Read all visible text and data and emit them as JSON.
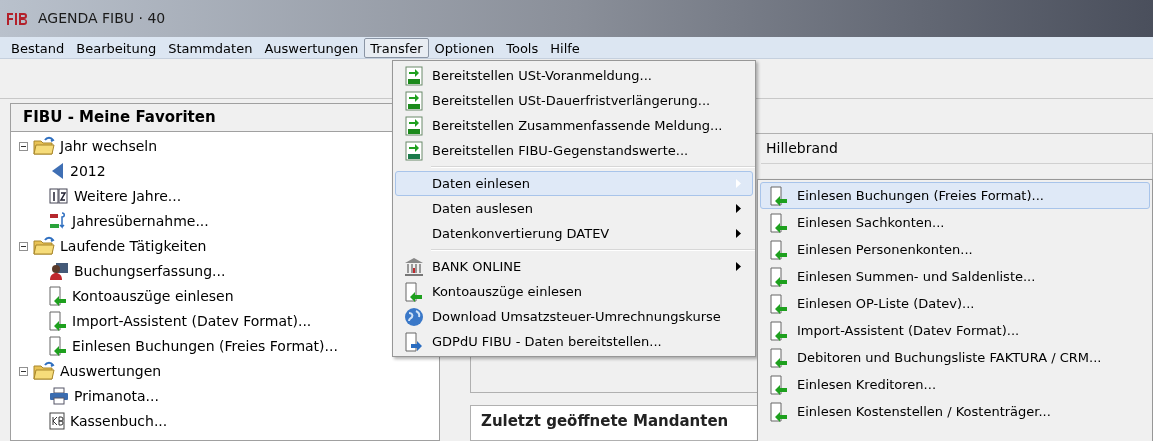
{
  "window": {
    "title": "AGENDA FIBU · 40"
  },
  "menu_bar": [
    {
      "label": "Bestand",
      "selected": false
    },
    {
      "label": "Bearbeitung",
      "selected": false
    },
    {
      "label": "Stammdaten",
      "selected": false
    },
    {
      "label": "Auswertungen",
      "selected": false
    },
    {
      "label": "Transfer",
      "selected": true
    },
    {
      "label": "Optionen",
      "selected": false
    },
    {
      "label": "Tools",
      "selected": false
    },
    {
      "label": "Hilfe",
      "selected": false
    }
  ],
  "favorites": {
    "title": "FIBU - Meine Favoriten",
    "tree": [
      {
        "label": "Jahr wechseln",
        "kind": "folder",
        "expanded": true,
        "children": [
          {
            "label": "2012",
            "kind": "back"
          },
          {
            "label": "Weitere Jahre...",
            "kind": "years"
          },
          {
            "label": "Jahresübernahme...",
            "kind": "altneu"
          }
        ]
      },
      {
        "label": "Laufende Tätigkeiten",
        "kind": "folder",
        "expanded": true,
        "children": [
          {
            "label": "Buchungserfassung...",
            "kind": "person"
          },
          {
            "label": "Kontoauszüge einlesen",
            "kind": "import"
          },
          {
            "label": "Import-Assistent (Datev Format)...",
            "kind": "import"
          },
          {
            "label": "Einlesen Buchungen (Freies Format)...",
            "kind": "import"
          }
        ]
      },
      {
        "label": "Auswertungen",
        "kind": "folder",
        "expanded": true,
        "children": [
          {
            "label": "Primanota...",
            "kind": "printer"
          },
          {
            "label": "Kassenbuch...",
            "kind": "kb"
          }
        ]
      }
    ]
  },
  "client_list": {
    "rows": [
      "Hillebrand"
    ]
  },
  "recent_clients": {
    "title": "Zuletzt geöffnete Mandanten"
  },
  "transfer_menu": {
    "items": [
      {
        "kind": "del",
        "label": "Bereitstellen USt-Voranmeldung...",
        "selected": false,
        "submenu": false
      },
      {
        "kind": "del",
        "label": "Bereitstellen USt-Dauerfristverlängerung...",
        "selected": false,
        "submenu": false
      },
      {
        "kind": "del",
        "label": "Bereitstellen Zusammenfassende Meldung...",
        "selected": false,
        "submenu": false
      },
      {
        "kind": "hon",
        "label": "Bereitstellen FIBU-Gegenstandswerte...",
        "selected": false,
        "submenu": false
      },
      {
        "kind": "separator"
      },
      {
        "kind": "plain",
        "label": "Daten einlesen",
        "selected": true,
        "submenu": true
      },
      {
        "kind": "plain",
        "label": "Daten auslesen",
        "selected": false,
        "submenu": true
      },
      {
        "kind": "plain",
        "label": "Datenkonvertierung DATEV",
        "selected": false,
        "submenu": true
      },
      {
        "kind": "separator"
      },
      {
        "kind": "bank",
        "label": "BANK ONLINE",
        "selected": false,
        "submenu": true
      },
      {
        "kind": "import",
        "label": "Kontoauszüge einlesen",
        "selected": false,
        "submenu": false
      },
      {
        "kind": "globe",
        "label": "Download Umsatzsteuer-Umrechnungskurse",
        "selected": false,
        "submenu": false
      },
      {
        "kind": "export",
        "label": "GDPdU FIBU - Daten bereitstellen...",
        "selected": false,
        "submenu": false
      }
    ]
  },
  "import_submenu": {
    "items": [
      {
        "label": "Einlesen Buchungen (Freies Format)...",
        "selected": true
      },
      {
        "label": "Einlesen Sachkonten...",
        "selected": false
      },
      {
        "label": "Einlesen Personenkonten...",
        "selected": false
      },
      {
        "label": "Einlesen Summen- und Saldenliste...",
        "selected": false
      },
      {
        "label": "Einlesen OP-Liste (Datev)...",
        "selected": false
      },
      {
        "label": "Import-Assistent (Datev Format)...",
        "selected": false
      },
      {
        "label": "Debitoren und Buchungsliste FAKTURA / CRM...",
        "selected": false
      },
      {
        "label": "Einlesen Kreditoren...",
        "selected": false
      },
      {
        "label": "Einlesen Kostenstellen / Kostenträger...",
        "selected": false
      }
    ]
  }
}
